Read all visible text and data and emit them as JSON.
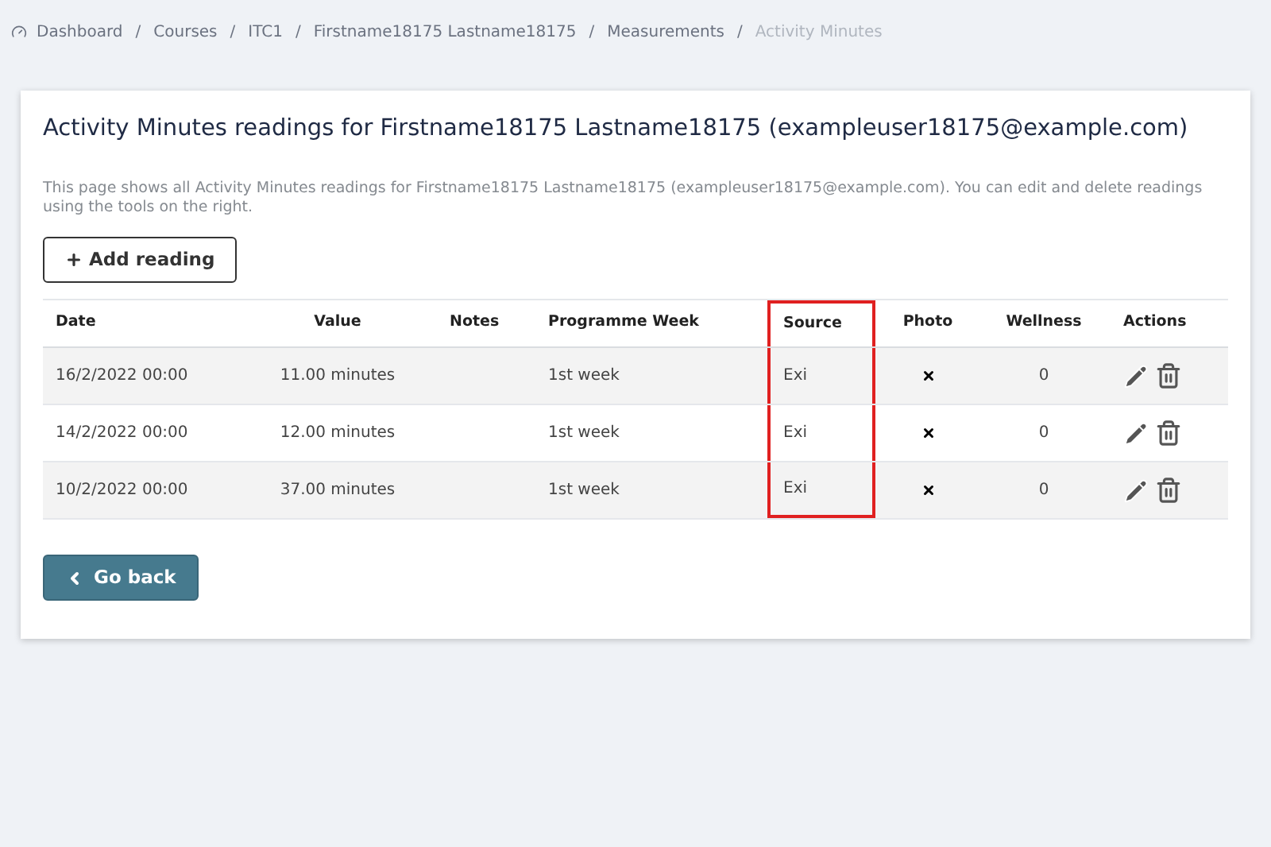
{
  "breadcrumb": [
    {
      "label": "Dashboard",
      "current": false
    },
    {
      "label": "Courses",
      "current": false
    },
    {
      "label": "ITC1",
      "current": false
    },
    {
      "label": "Firstname18175 Lastname18175",
      "current": false
    },
    {
      "label": "Measurements",
      "current": false
    },
    {
      "label": "Activity Minutes",
      "current": true
    }
  ],
  "breadcrumb_separator": "/",
  "title": "Activity Minutes readings for Firstname18175 Lastname18175 (exampleuser18175@example.com)",
  "description": "This page shows all Activity Minutes readings for Firstname18175 Lastname18175 (exampleuser18175@example.com). You can edit and delete readings using the tools on the right.",
  "add_button": "Add reading",
  "table": {
    "columns": [
      {
        "label": "Date",
        "highlighted": false
      },
      {
        "label": "Value",
        "highlighted": false
      },
      {
        "label": "Notes",
        "highlighted": false
      },
      {
        "label": "Programme Week",
        "highlighted": false
      },
      {
        "label": "Source",
        "highlighted": true
      },
      {
        "label": "Photo",
        "highlighted": false
      },
      {
        "label": "Wellness",
        "highlighted": false
      },
      {
        "label": "Actions",
        "highlighted": false
      }
    ],
    "rows": [
      {
        "date": "16/2/2022 00:00",
        "value": "11.00 minutes",
        "notes": "",
        "week": "1st week",
        "source": "Exi",
        "photo": false,
        "wellness": "0"
      },
      {
        "date": "14/2/2022 00:00",
        "value": "12.00 minutes",
        "notes": "",
        "week": "1st week",
        "source": "Exi",
        "photo": false,
        "wellness": "0"
      },
      {
        "date": "10/2/2022 00:00",
        "value": "37.00 minutes",
        "notes": "",
        "week": "1st week",
        "source": "Exi",
        "photo": false,
        "wellness": "0"
      }
    ]
  },
  "back_button": "Go back"
}
